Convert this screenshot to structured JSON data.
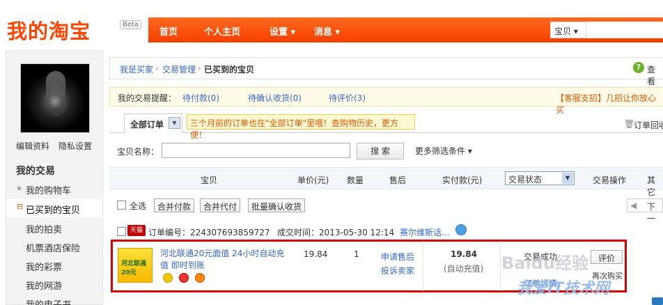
{
  "header": {
    "logo": "我的淘宝",
    "beta": "Beta",
    "nav": [
      "首页",
      "个人主页",
      "设置 ▾",
      "消息 ▾"
    ],
    "search_type": "宝贝 ▾"
  },
  "sidebar": {
    "profile_link": "编辑资料",
    "privacy_link": "隐私设置",
    "section_title": "我的交易",
    "items": [
      {
        "label": "我的购物车",
        "marker": "▪"
      },
      {
        "label": "已买到的宝贝",
        "marker": "⊟"
      },
      {
        "label": "我的拍卖",
        "marker": ""
      },
      {
        "label": "机票酒店保险",
        "marker": ""
      },
      {
        "label": "我的彩票",
        "marker": ""
      },
      {
        "label": "我的网游",
        "marker": ""
      },
      {
        "label": "我的电子书",
        "marker": ""
      }
    ]
  },
  "breadcrumb": {
    "items": [
      "我是买家",
      "交易管理"
    ],
    "sep": "›",
    "current": "已买到的宝贝",
    "help": "查看"
  },
  "reminder": {
    "label": "我的交易提醒：",
    "pending_pay": "待付款(0)",
    "pending_confirm": "待确认收货(0)",
    "pending_review": "待评价(3)",
    "promo": "【客服支招】几招让你放心买"
  },
  "tabs": {
    "all_orders": "全部订单",
    "tip": "三个月前的订单也在\"全部订单\"里哦！查购物历史，更方便！",
    "recycle": "订单回收"
  },
  "filter": {
    "name_label": "宝贝名称：",
    "search_button": "搜 索",
    "more_filters": "更多筛选条件 ▾"
  },
  "table": {
    "headers": [
      "宝贝",
      "单价(元)",
      "数量",
      "售后",
      "实付款(元)",
      "交易操作",
      "其它"
    ],
    "status_select": "交易状态"
  },
  "bulk": {
    "select_all": "全选",
    "merge_pay": "合并付款",
    "merge_agent": "合并代付",
    "batch_confirm": "批量确认收货",
    "next_page": "下一"
  },
  "order": {
    "tmall_badge": "天猫",
    "order_no": "订单编号：224307693859727",
    "deal_time": "成交时间：2013-05-30 12:14",
    "seller": "赛尔维斯话...",
    "product_title": "河北联通20元面值 24小时自动充值 即时到账",
    "product_image_text": "河北联通20元",
    "price": "19.84",
    "qty": "1",
    "after_sale_1": "申请售后",
    "after_sale_2": "投诉卖家",
    "paid": "19.84",
    "paid_note": "(自动充值)",
    "status": "交易成功",
    "status_detail": "订单详情",
    "op": "评价",
    "rebuy": "再次购买"
  },
  "watermark": {
    "baidu": "Baidu经验",
    "site": "我爱IT技术网"
  },
  "colors": {
    "brand": "#ff4400",
    "link": "#3366cc",
    "highlight_border": "#d40000"
  }
}
